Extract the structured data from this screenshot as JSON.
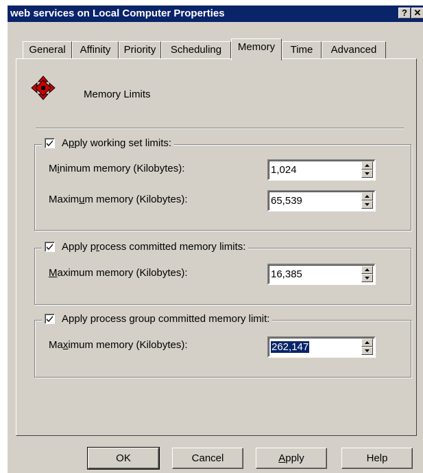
{
  "window": {
    "title": "web services on Local Computer Properties"
  },
  "titlebar": {
    "help_label": "?",
    "close_label": "✕"
  },
  "tabs": [
    {
      "label": "General"
    },
    {
      "label": "Affinity"
    },
    {
      "label": "Priority"
    },
    {
      "label": "Scheduling"
    },
    {
      "label": "Memory",
      "active": true
    },
    {
      "label": "Time"
    },
    {
      "label": "Advanced"
    }
  ],
  "header": {
    "icon": "memory-limits-icon",
    "title": "Memory Limits"
  },
  "groups": {
    "working_set": {
      "checked": true,
      "label_pre": "A",
      "label_key": "p",
      "label_post": "ply working set limits:",
      "min_pre": "M",
      "min_key": "i",
      "min_post": "nimum memory (Kilobytes):",
      "min_value": "1,024",
      "max_pre": "Maxim",
      "max_key": "u",
      "max_post": "m memory (Kilobytes):",
      "max_value": "65,539"
    },
    "process_committed": {
      "checked": true,
      "label_pre": "Apply p",
      "label_key": "r",
      "label_post": "ocess committed memory limits:",
      "max_pre": "",
      "max_key": "M",
      "max_post": "aximum memory (Kilobytes):",
      "max_value": "16,385"
    },
    "group_committed": {
      "checked": true,
      "label_pre": "Apply process ",
      "label_key": "g",
      "label_post": "roup committed memory limit:",
      "max_pre": "Ma",
      "max_key": "x",
      "max_post": "imum memory (Kilobytes):",
      "max_value": "262,147"
    }
  },
  "buttons": {
    "ok": "OK",
    "cancel": "Cancel",
    "apply_pre": "",
    "apply_key": "A",
    "apply_post": "pply",
    "help": "Help"
  }
}
